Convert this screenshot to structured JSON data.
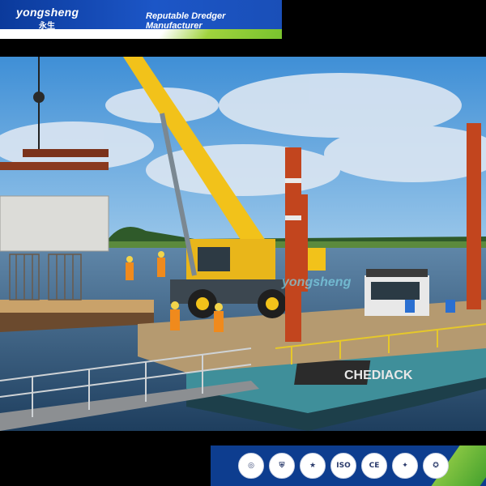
{
  "banner": {
    "brand": "yongsheng",
    "brand_cn": "永生",
    "tagline": "Reputable Dredger Manufacturer"
  },
  "photo": {
    "barge_name": "CHEDIACK",
    "watermark": "yongsheng"
  },
  "certifications": [
    {
      "icon": "quality-seal-icon",
      "glyph": "◎"
    },
    {
      "icon": "shield-cert-icon",
      "glyph": "⛨"
    },
    {
      "icon": "award-icon",
      "glyph": "★"
    },
    {
      "icon": "iso-icon",
      "glyph": "ISO"
    },
    {
      "icon": "ce-mark-icon",
      "glyph": "CE"
    },
    {
      "icon": "flame-cert-icon",
      "glyph": "✦"
    },
    {
      "icon": "seal-icon",
      "glyph": "✪"
    }
  ],
  "colors": {
    "banner_blue": "#1c56c7",
    "accent_green": "#6fbf2a",
    "crane_yellow": "#f2c21a",
    "spud_orange": "#c2451e",
    "water": "#1e3e5e"
  }
}
